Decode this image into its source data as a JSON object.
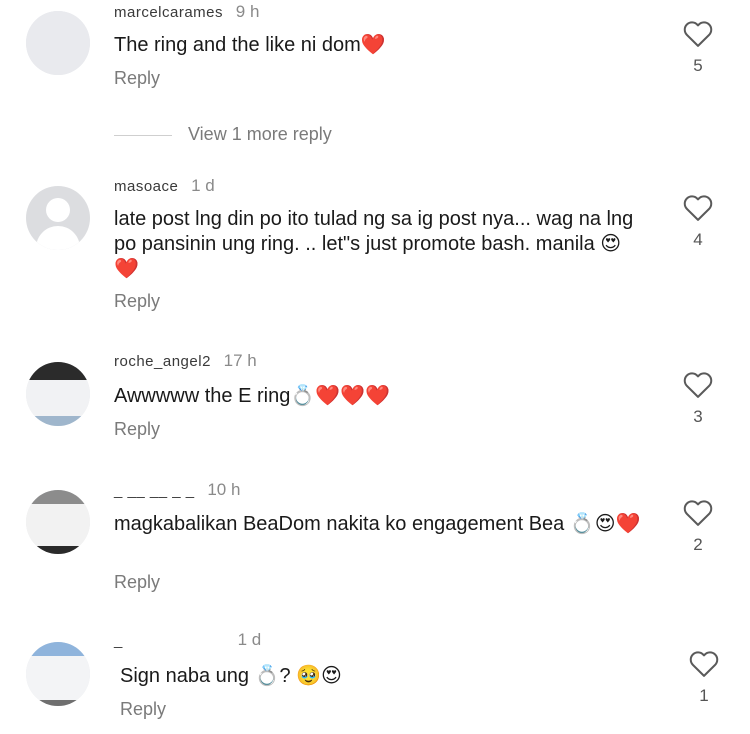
{
  "comments": [
    {
      "username": "marcelcarames",
      "time": "9 h",
      "text": "The ring and the like ni dom❤️",
      "reply_label": "Reply",
      "likes": "5"
    },
    {
      "username": "masoace",
      "time": "1 d",
      "text": "late post lng din po ito tulad ng sa ig post nya... wag na lng po pansinin ung ring. .. let\"s just promote bash. manila 😍❤️",
      "reply_label": "Reply",
      "likes": "4"
    },
    {
      "username": "roche_angel2",
      "time": "17 h",
      "text": "Awwwww the E ring💍❤️❤️❤️",
      "reply_label": "Reply",
      "likes": "3"
    },
    {
      "username": "_ __ __ _ _",
      "time": "10 h",
      "text": "magkabalikan BeaDom nakita ko engagement Bea 💍😍❤️",
      "reply_label": "Reply",
      "likes": "2"
    },
    {
      "username": "_",
      "time": "1 d",
      "text": "Sign naba ung 💍? 🥹😍",
      "reply_label": "Reply",
      "likes": "1"
    }
  ],
  "view_more": {
    "label": "View 1 more reply"
  },
  "colors": {
    "heart_outline": "#5a5a5a",
    "heart_fill": "#e0202f",
    "muted_text": "#7a7a7a"
  }
}
